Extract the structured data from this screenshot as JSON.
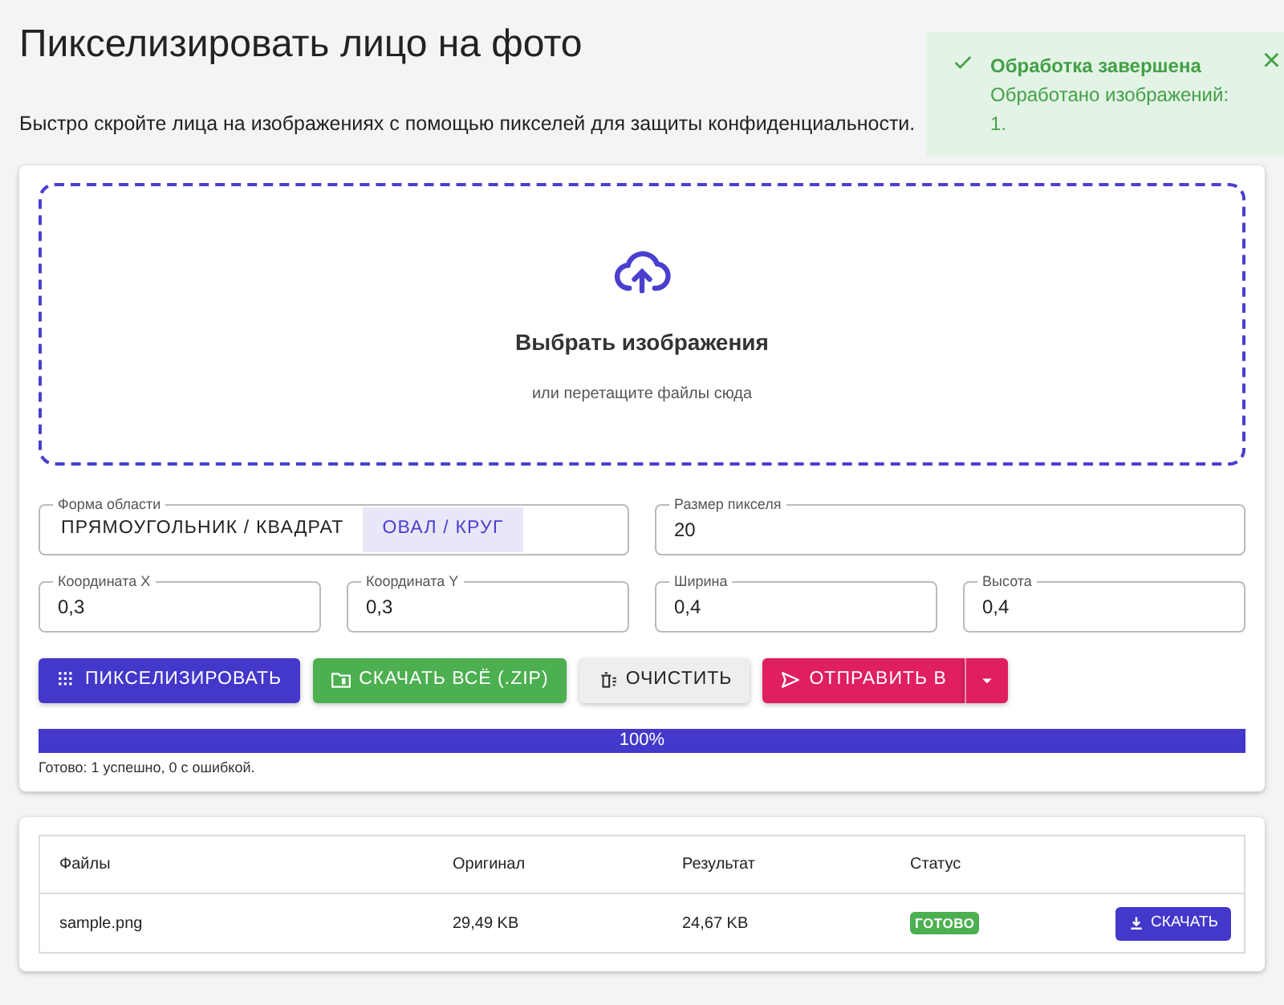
{
  "page": {
    "title": "Пикселизировать лицо на фото",
    "subtitle": "Быстро скройте лица на изображениях с помощью пикселей для защиты конфиденциальности."
  },
  "toast": {
    "title": "Обработка завершена",
    "message": "Обработано изображений: 1.",
    "close": "×"
  },
  "dropzone": {
    "title": "Выбрать изображения",
    "hint": "или перетащите файлы сюда"
  },
  "shape": {
    "label": "Форма области",
    "options": [
      {
        "label": "ПРЯМОУГОЛЬНИК / КВАДРАТ",
        "selected": false
      },
      {
        "label": "ОВАЛ / КРУГ",
        "selected": true
      }
    ]
  },
  "pixel_size": {
    "label": "Размер пикселя",
    "value": "20"
  },
  "coords": [
    {
      "label": "Координата X",
      "value": "0,3"
    },
    {
      "label": "Координата Y",
      "value": "0,3"
    },
    {
      "label": "Ширина",
      "value": "0,4"
    },
    {
      "label": "Высота",
      "value": "0,4"
    }
  ],
  "buttons": [
    {
      "label": "ПИКСЕЛИЗИРОВАТЬ",
      "kind": "pixelate"
    },
    {
      "label": "СКАЧАТЬ ВСЁ (.ZIP)",
      "kind": "zip"
    },
    {
      "label": "ОЧИСТИТЬ",
      "kind": "clear"
    },
    {
      "label": "ОТПРАВИТЬ В",
      "kind": "send"
    }
  ],
  "progress": {
    "level": 1,
    "reading": "100%",
    "summary": "Готово: 1 успешно, 0 с ошибкой."
  },
  "table": {
    "columns": [
      "Файлы",
      "Оригинал",
      "Результат",
      "Статус"
    ],
    "rows": [
      {
        "file": "sample.png",
        "original": "29,49 KB",
        "result": "24,67 KB",
        "status": "ГОТОВО",
        "action": "СКАЧАТЬ"
      }
    ]
  }
}
